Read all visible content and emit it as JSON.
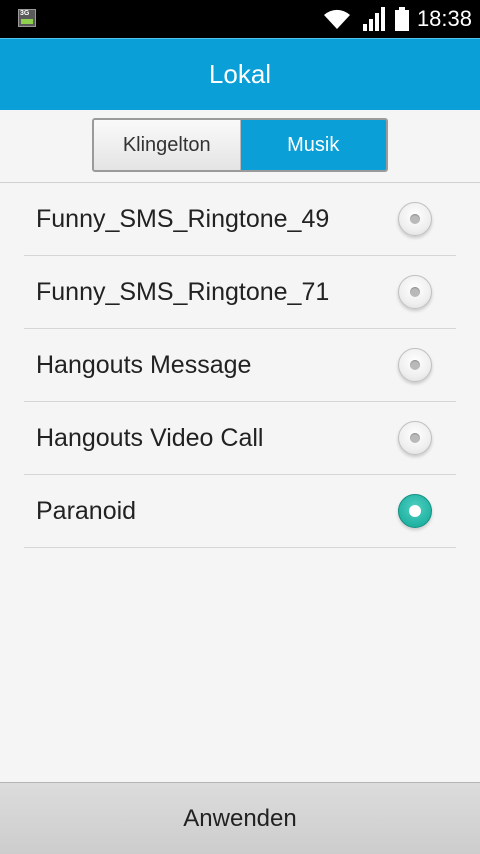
{
  "status_bar": {
    "network_badge": "3G",
    "time": "18:38",
    "icons": [
      "sim-3g-icon",
      "wifi-icon",
      "signal-icon",
      "battery-icon"
    ]
  },
  "title_bar": {
    "title": "Lokal"
  },
  "tabs": [
    {
      "label": "Klingelton",
      "selected": false
    },
    {
      "label": "Musik",
      "selected": true
    }
  ],
  "list": {
    "items": [
      {
        "label": "Funny_SMS_Ringtone_49",
        "checked": false
      },
      {
        "label": "Funny_SMS_Ringtone_71",
        "checked": false
      },
      {
        "label": "Hangouts Message",
        "checked": false
      },
      {
        "label": "Hangouts Video Call",
        "checked": false
      },
      {
        "label": "Paranoid",
        "checked": true
      }
    ]
  },
  "footer": {
    "apply_label": "Anwenden"
  },
  "colors": {
    "accent": "#0a9fd6",
    "radio_selected": "#22b3a3",
    "background": "#f5f5f5"
  }
}
